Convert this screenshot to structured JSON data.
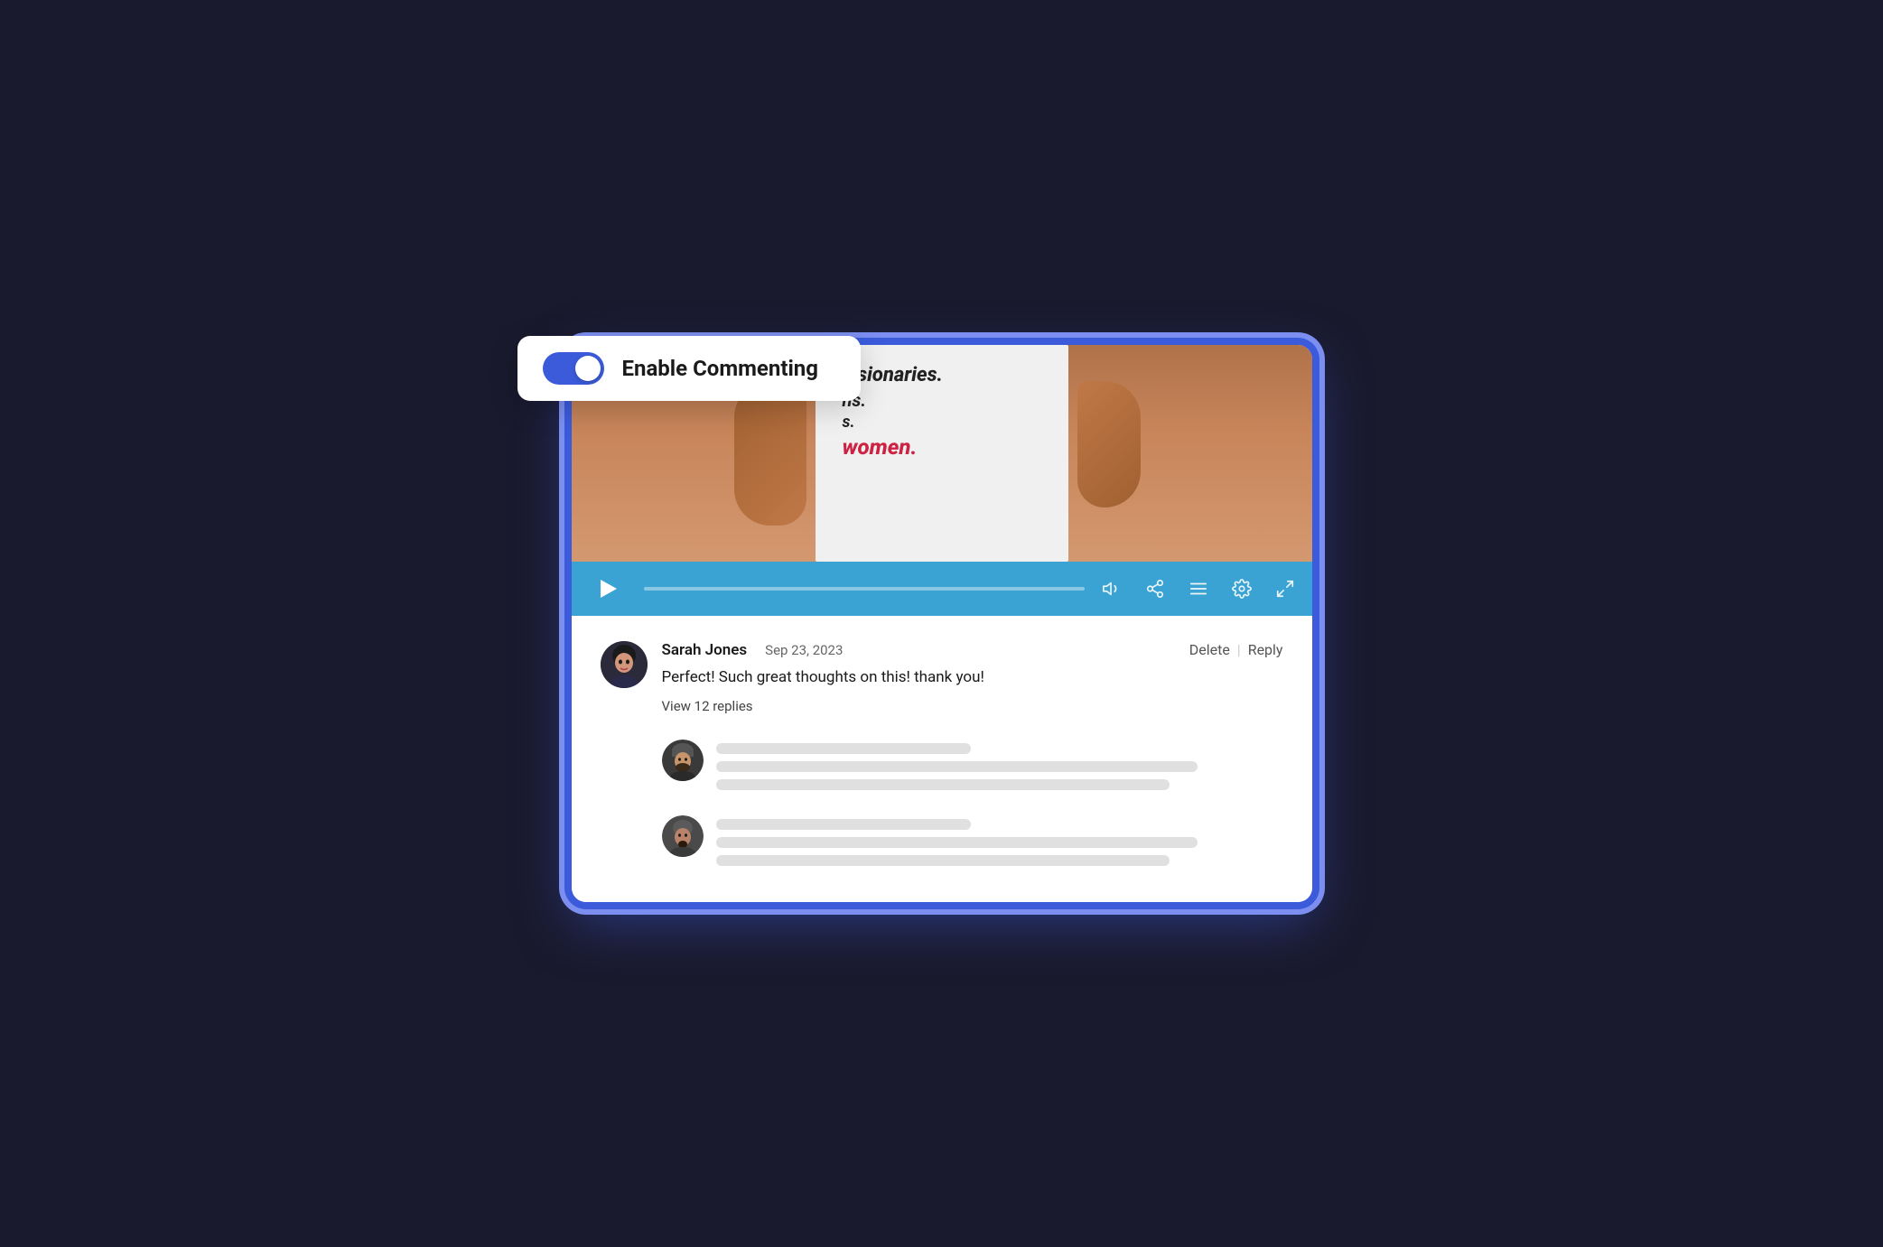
{
  "toggle": {
    "label": "Enable Commenting",
    "enabled": true,
    "track_color": "#3b5bdb"
  },
  "video": {
    "text_lines": [
      "visionaries.",
      "ns.",
      "s.",
      "women."
    ]
  },
  "toolbar": {
    "play_title": "Play",
    "volume_icon": "volume-icon",
    "share_icon": "share-icon",
    "playlist_icon": "playlist-icon",
    "settings_icon": "settings-icon",
    "fullscreen_icon": "fullscreen-icon"
  },
  "comment": {
    "author": "Sarah Jones",
    "date": "Sep 23, 2023",
    "text": "Perfect! Such great thoughts on this! thank you!",
    "delete_label": "Delete",
    "divider": "|",
    "reply_label": "Reply",
    "view_replies_label": "View 12 replies"
  },
  "replies": [
    {
      "id": "reply-1",
      "skeleton_lines": [
        "short",
        "long",
        "medium"
      ]
    },
    {
      "id": "reply-2",
      "skeleton_lines": [
        "short",
        "long",
        "medium"
      ]
    }
  ]
}
